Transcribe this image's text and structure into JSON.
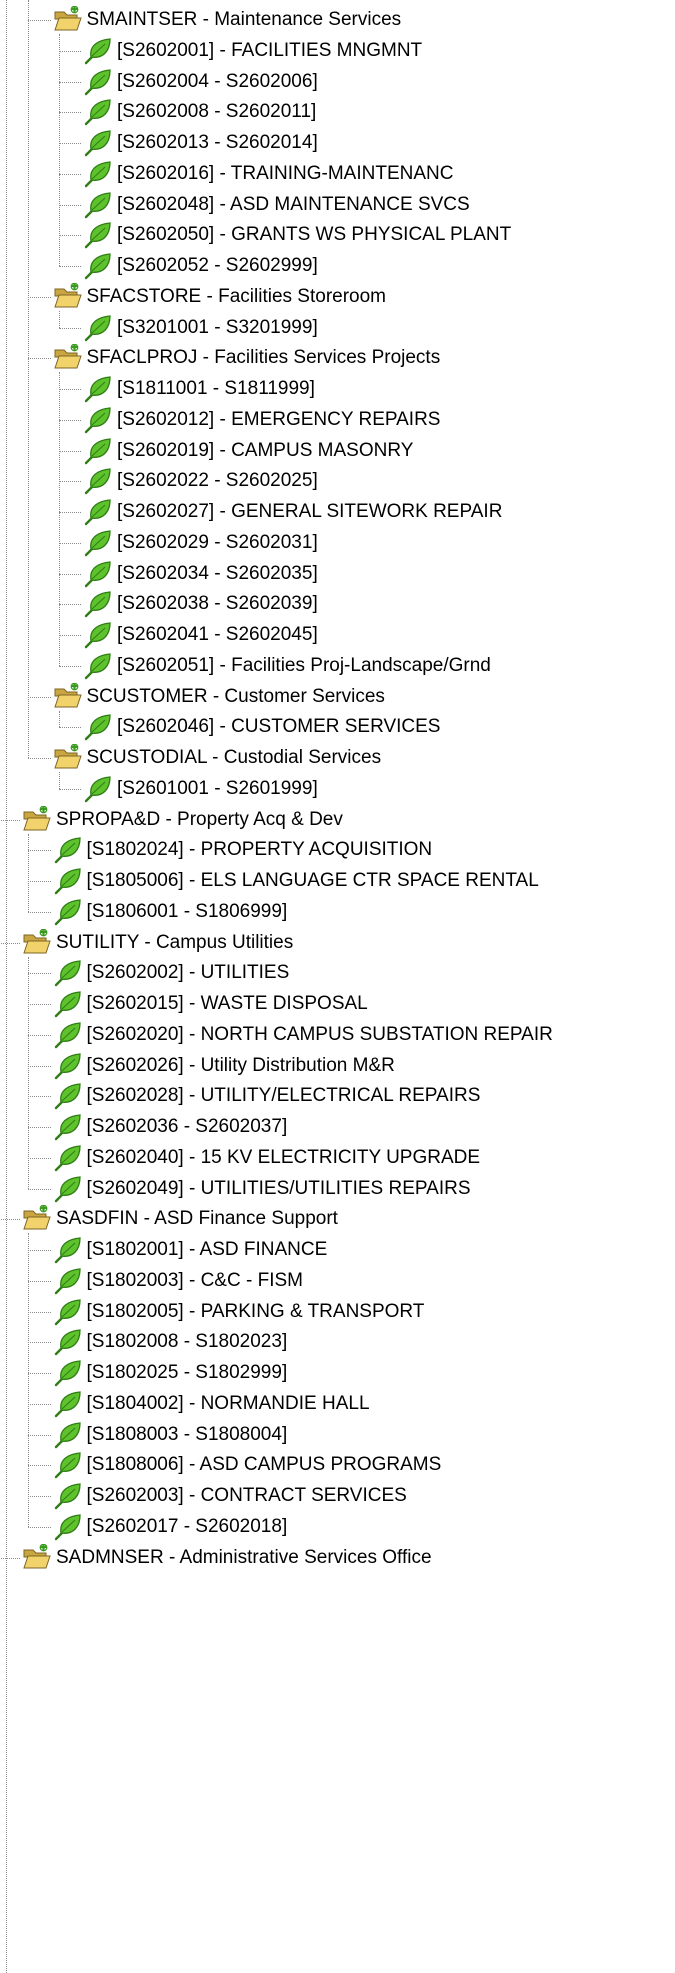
{
  "tree": [
    {
      "label": "SMAINTSER - Maintenance Services",
      "type": "folder",
      "depth": 1,
      "last": false,
      "children": [
        {
          "label": "[S2602001] - FACILITIES MNGMNT",
          "type": "leaf",
          "depth": 2
        },
        {
          "label": "[S2602004 - S2602006]",
          "type": "leaf",
          "depth": 2
        },
        {
          "label": "[S2602008 - S2602011]",
          "type": "leaf",
          "depth": 2
        },
        {
          "label": "[S2602013 - S2602014]",
          "type": "leaf",
          "depth": 2
        },
        {
          "label": "[S2602016] - TRAINING-MAINTENANC",
          "type": "leaf",
          "depth": 2
        },
        {
          "label": "[S2602048] - ASD MAINTENANCE SVCS",
          "type": "leaf",
          "depth": 2
        },
        {
          "label": "[S2602050] - GRANTS WS PHYSICAL PLANT",
          "type": "leaf",
          "depth": 2
        },
        {
          "label": "[S2602052 - S2602999]",
          "type": "leaf",
          "depth": 2
        }
      ]
    },
    {
      "label": "SFACSTORE - Facilities Storeroom",
      "type": "folder",
      "depth": 1,
      "last": false,
      "children": [
        {
          "label": "[S3201001 - S3201999]",
          "type": "leaf",
          "depth": 2
        }
      ]
    },
    {
      "label": "SFACLPROJ - Facilities Services Projects",
      "type": "folder",
      "depth": 1,
      "last": false,
      "children": [
        {
          "label": "[S1811001 - S1811999]",
          "type": "leaf",
          "depth": 2
        },
        {
          "label": "[S2602012] - EMERGENCY REPAIRS",
          "type": "leaf",
          "depth": 2
        },
        {
          "label": "[S2602019] - CAMPUS MASONRY",
          "type": "leaf",
          "depth": 2
        },
        {
          "label": "[S2602022 - S2602025]",
          "type": "leaf",
          "depth": 2
        },
        {
          "label": "[S2602027] - GENERAL SITEWORK REPAIR",
          "type": "leaf",
          "depth": 2
        },
        {
          "label": "[S2602029 - S2602031]",
          "type": "leaf",
          "depth": 2
        },
        {
          "label": "[S2602034 - S2602035]",
          "type": "leaf",
          "depth": 2
        },
        {
          "label": "[S2602038 - S2602039]",
          "type": "leaf",
          "depth": 2
        },
        {
          "label": "[S2602041 - S2602045]",
          "type": "leaf",
          "depth": 2
        },
        {
          "label": "[S2602051] - Facilities Proj-Landscape/Grnd",
          "type": "leaf",
          "depth": 2
        }
      ]
    },
    {
      "label": "SCUSTOMER - Customer Services",
      "type": "folder",
      "depth": 1,
      "last": false,
      "children": [
        {
          "label": "[S2602046] - CUSTOMER SERVICES",
          "type": "leaf",
          "depth": 2
        }
      ]
    },
    {
      "label": "SCUSTODIAL - Custodial Services",
      "type": "folder",
      "depth": 1,
      "last": true,
      "children": [
        {
          "label": "[S2601001 - S2601999]",
          "type": "leaf",
          "depth": 2
        }
      ]
    },
    {
      "label": "SPROPA&D - Property Acq & Dev",
      "type": "folder",
      "depth": 0,
      "last": false,
      "children": [
        {
          "label": "[S1802024] - PROPERTY ACQUISITION",
          "type": "leaf",
          "depth": 1
        },
        {
          "label": "[S1805006] - ELS LANGUAGE CTR SPACE RENTAL",
          "type": "leaf",
          "depth": 1
        },
        {
          "label": "[S1806001 - S1806999]",
          "type": "leaf",
          "depth": 1
        }
      ]
    },
    {
      "label": "SUTILITY - Campus Utilities",
      "type": "folder",
      "depth": 0,
      "last": false,
      "children": [
        {
          "label": "[S2602002] - UTILITIES",
          "type": "leaf",
          "depth": 1
        },
        {
          "label": "[S2602015] - WASTE DISPOSAL",
          "type": "leaf",
          "depth": 1
        },
        {
          "label": "[S2602020] - NORTH CAMPUS SUBSTATION REPAIR",
          "type": "leaf",
          "depth": 1
        },
        {
          "label": "[S2602026] - Utility Distribution M&R",
          "type": "leaf",
          "depth": 1
        },
        {
          "label": "[S2602028] - UTILITY/ELECTRICAL REPAIRS",
          "type": "leaf",
          "depth": 1
        },
        {
          "label": "[S2602036 - S2602037]",
          "type": "leaf",
          "depth": 1
        },
        {
          "label": "[S2602040] - 15 KV ELECTRICITY UPGRADE",
          "type": "leaf",
          "depth": 1
        },
        {
          "label": "[S2602049] - UTILITIES/UTILITIES REPAIRS",
          "type": "leaf",
          "depth": 1
        }
      ]
    },
    {
      "label": "SASDFIN - ASD Finance Support",
      "type": "folder",
      "depth": 0,
      "last": false,
      "children": [
        {
          "label": "[S1802001] - ASD FINANCE",
          "type": "leaf",
          "depth": 1
        },
        {
          "label": "[S1802003] - C&C - FISM",
          "type": "leaf",
          "depth": 1
        },
        {
          "label": "[S1802005] - PARKING & TRANSPORT",
          "type": "leaf",
          "depth": 1
        },
        {
          "label": "[S1802008 - S1802023]",
          "type": "leaf",
          "depth": 1
        },
        {
          "label": "[S1802025 - S1802999]",
          "type": "leaf",
          "depth": 1
        },
        {
          "label": "[S1804002] - NORMANDIE HALL",
          "type": "leaf",
          "depth": 1
        },
        {
          "label": "[S1808003 - S1808004]",
          "type": "leaf",
          "depth": 1
        },
        {
          "label": "[S1808006] - ASD CAMPUS PROGRAMS",
          "type": "leaf",
          "depth": 1
        },
        {
          "label": "[S2602003] - CONTRACT SERVICES",
          "type": "leaf",
          "depth": 1
        },
        {
          "label": "[S2602017 - S2602018]",
          "type": "leaf",
          "depth": 1
        }
      ]
    },
    {
      "label": "SADMNSER - Administrative Services Office",
      "type": "folder",
      "depth": 0,
      "last": false,
      "children": []
    }
  ],
  "icons": {
    "folder": "folder-open-icon",
    "leaf": "leaf-icon"
  },
  "colors": {
    "connector": "#8a8a8a",
    "leaf_green": "#3fa21f",
    "folder_yellow": "#f2d36b"
  }
}
